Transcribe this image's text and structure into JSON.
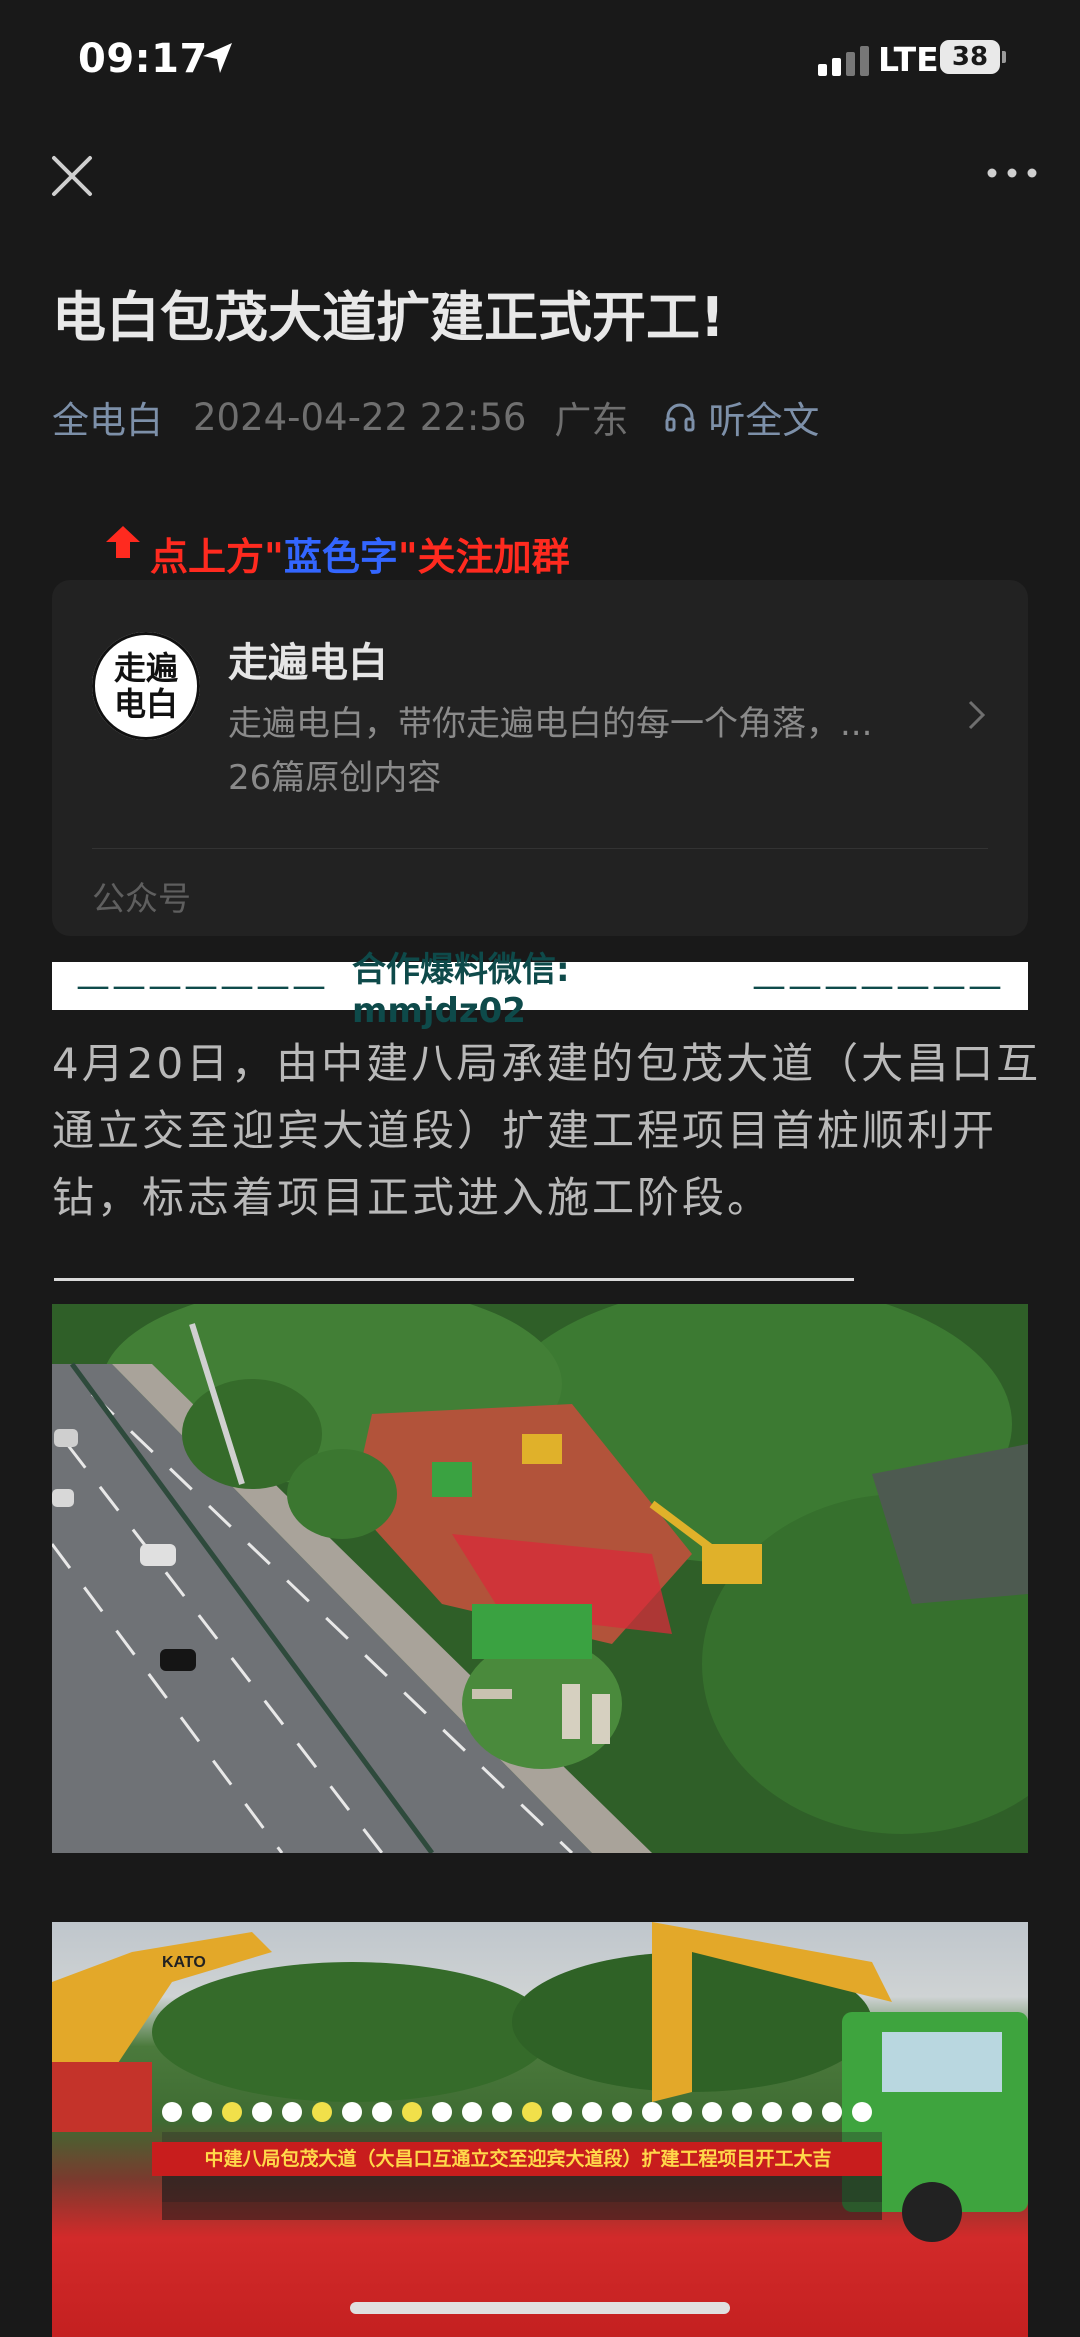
{
  "status": {
    "time": "09:17",
    "network": "LTE",
    "battery": "38"
  },
  "article": {
    "title": "电白包茂大道扩建正式开工!",
    "author": "全电白",
    "datetime": "2024-04-22 22:56",
    "location": "广东",
    "listen_label": "听全文"
  },
  "follow": {
    "prefix": "点上方\"",
    "highlight": "蓝色字",
    "suffix": "\"关注加群"
  },
  "account": {
    "avatar_line1": "走遍",
    "avatar_line2": "电白",
    "name": "走遍电白",
    "description": "走遍电白，带你走遍电白的每一个角落，...",
    "count": "26篇原创内容",
    "type": "公众号"
  },
  "banner": {
    "dash_left": "———————",
    "text": "合作爆料微信: mmjdz02",
    "dash_right": "———————"
  },
  "body": {
    "paragraph": "4月20日，由中建八局承建的包茂大道（大昌口互通立交至迎宾大道段）扩建工程项目首桩顺利开钻，标志着项目正式进入施工阶段。"
  },
  "photo2": {
    "banner_text": "中建八局包茂大道（大昌口互通立交至迎宾大道段）扩建工程项目开工大吉",
    "excavator_brand": "KATO"
  },
  "colors": {
    "background": "#191919",
    "link": "#7d90a9",
    "follow_red": "#ff2a1f",
    "follow_blue": "#3366ff"
  },
  "icons": [
    "location-arrow-icon",
    "signal-icon",
    "battery-icon",
    "close-icon",
    "more-icon",
    "headphones-icon",
    "hand-pointer-icon",
    "chevron-right-icon"
  ]
}
